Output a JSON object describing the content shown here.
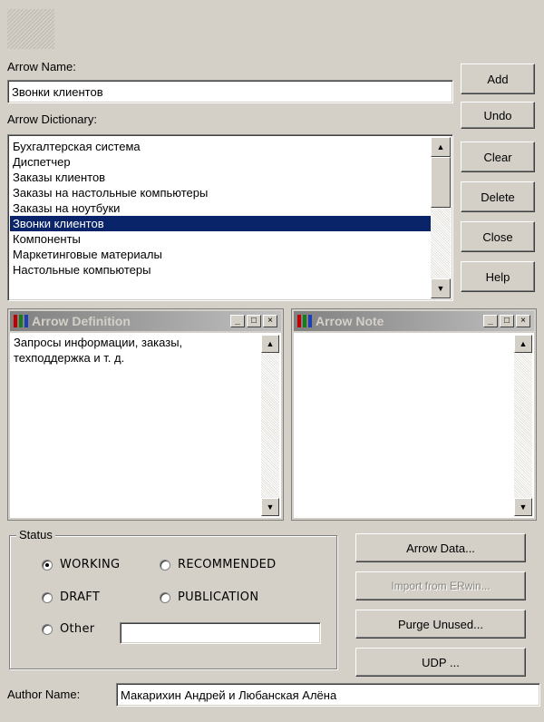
{
  "arrow_name": {
    "label": "Arrow Name:",
    "value": "Звонки клиентов"
  },
  "arrow_dictionary": {
    "label": "Arrow Dictionary:",
    "items": [
      "Бухгалтерская система",
      "Диспетчер",
      "Заказы клиентов",
      "Заказы на настольные компьютеры",
      "Заказы на ноутбуки",
      "Звонки клиентов",
      "Компоненты",
      "Маркетинговые материалы",
      "Настольные компьютеры"
    ],
    "selected_index": 5
  },
  "side_buttons": {
    "add": "Add",
    "undo": "Undo",
    "clear": "Clear",
    "delete": "Delete",
    "close": "Close",
    "help": "Help"
  },
  "definition_panel": {
    "title": "Arrow Definition",
    "text": "Запросы информации, заказы,\nтехподдержка и т. д."
  },
  "note_panel": {
    "title": "Arrow Note",
    "text": ""
  },
  "status": {
    "legend": "Status",
    "options": {
      "working": "WORKING",
      "recommended": "RECOMMENDED",
      "draft": "DRAFT",
      "publication": "PUBLICATION",
      "other": "Other"
    },
    "selected": "working",
    "other_value": ""
  },
  "action_buttons": {
    "arrow_data": "Arrow Data...",
    "import_erwin": "Import from ERwin...",
    "purge_unused": "Purge Unused...",
    "udp": "UDP ..."
  },
  "author": {
    "label": "Author Name:",
    "value": "Макарихин Андрей и Любанская Алёна"
  }
}
